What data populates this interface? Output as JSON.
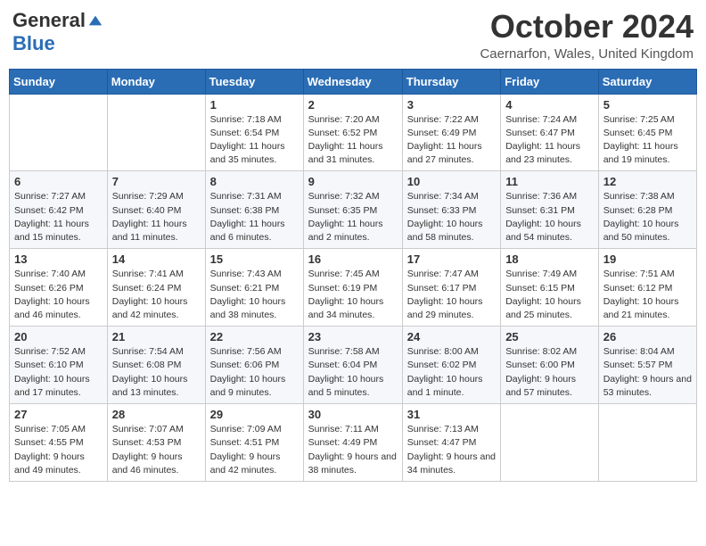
{
  "header": {
    "logo": {
      "general": "General",
      "blue": "Blue",
      "tagline": ""
    },
    "title": "October 2024",
    "location": "Caernarfon, Wales, United Kingdom"
  },
  "weekdays": [
    "Sunday",
    "Monday",
    "Tuesday",
    "Wednesday",
    "Thursday",
    "Friday",
    "Saturday"
  ],
  "weeks": [
    [
      {
        "day": "",
        "sunrise": "",
        "sunset": "",
        "daylight": ""
      },
      {
        "day": "",
        "sunrise": "",
        "sunset": "",
        "daylight": ""
      },
      {
        "day": "1",
        "sunrise": "Sunrise: 7:18 AM",
        "sunset": "Sunset: 6:54 PM",
        "daylight": "Daylight: 11 hours and 35 minutes."
      },
      {
        "day": "2",
        "sunrise": "Sunrise: 7:20 AM",
        "sunset": "Sunset: 6:52 PM",
        "daylight": "Daylight: 11 hours and 31 minutes."
      },
      {
        "day": "3",
        "sunrise": "Sunrise: 7:22 AM",
        "sunset": "Sunset: 6:49 PM",
        "daylight": "Daylight: 11 hours and 27 minutes."
      },
      {
        "day": "4",
        "sunrise": "Sunrise: 7:24 AM",
        "sunset": "Sunset: 6:47 PM",
        "daylight": "Daylight: 11 hours and 23 minutes."
      },
      {
        "day": "5",
        "sunrise": "Sunrise: 7:25 AM",
        "sunset": "Sunset: 6:45 PM",
        "daylight": "Daylight: 11 hours and 19 minutes."
      }
    ],
    [
      {
        "day": "6",
        "sunrise": "Sunrise: 7:27 AM",
        "sunset": "Sunset: 6:42 PM",
        "daylight": "Daylight: 11 hours and 15 minutes."
      },
      {
        "day": "7",
        "sunrise": "Sunrise: 7:29 AM",
        "sunset": "Sunset: 6:40 PM",
        "daylight": "Daylight: 11 hours and 11 minutes."
      },
      {
        "day": "8",
        "sunrise": "Sunrise: 7:31 AM",
        "sunset": "Sunset: 6:38 PM",
        "daylight": "Daylight: 11 hours and 6 minutes."
      },
      {
        "day": "9",
        "sunrise": "Sunrise: 7:32 AM",
        "sunset": "Sunset: 6:35 PM",
        "daylight": "Daylight: 11 hours and 2 minutes."
      },
      {
        "day": "10",
        "sunrise": "Sunrise: 7:34 AM",
        "sunset": "Sunset: 6:33 PM",
        "daylight": "Daylight: 10 hours and 58 minutes."
      },
      {
        "day": "11",
        "sunrise": "Sunrise: 7:36 AM",
        "sunset": "Sunset: 6:31 PM",
        "daylight": "Daylight: 10 hours and 54 minutes."
      },
      {
        "day": "12",
        "sunrise": "Sunrise: 7:38 AM",
        "sunset": "Sunset: 6:28 PM",
        "daylight": "Daylight: 10 hours and 50 minutes."
      }
    ],
    [
      {
        "day": "13",
        "sunrise": "Sunrise: 7:40 AM",
        "sunset": "Sunset: 6:26 PM",
        "daylight": "Daylight: 10 hours and 46 minutes."
      },
      {
        "day": "14",
        "sunrise": "Sunrise: 7:41 AM",
        "sunset": "Sunset: 6:24 PM",
        "daylight": "Daylight: 10 hours and 42 minutes."
      },
      {
        "day": "15",
        "sunrise": "Sunrise: 7:43 AM",
        "sunset": "Sunset: 6:21 PM",
        "daylight": "Daylight: 10 hours and 38 minutes."
      },
      {
        "day": "16",
        "sunrise": "Sunrise: 7:45 AM",
        "sunset": "Sunset: 6:19 PM",
        "daylight": "Daylight: 10 hours and 34 minutes."
      },
      {
        "day": "17",
        "sunrise": "Sunrise: 7:47 AM",
        "sunset": "Sunset: 6:17 PM",
        "daylight": "Daylight: 10 hours and 29 minutes."
      },
      {
        "day": "18",
        "sunrise": "Sunrise: 7:49 AM",
        "sunset": "Sunset: 6:15 PM",
        "daylight": "Daylight: 10 hours and 25 minutes."
      },
      {
        "day": "19",
        "sunrise": "Sunrise: 7:51 AM",
        "sunset": "Sunset: 6:12 PM",
        "daylight": "Daylight: 10 hours and 21 minutes."
      }
    ],
    [
      {
        "day": "20",
        "sunrise": "Sunrise: 7:52 AM",
        "sunset": "Sunset: 6:10 PM",
        "daylight": "Daylight: 10 hours and 17 minutes."
      },
      {
        "day": "21",
        "sunrise": "Sunrise: 7:54 AM",
        "sunset": "Sunset: 6:08 PM",
        "daylight": "Daylight: 10 hours and 13 minutes."
      },
      {
        "day": "22",
        "sunrise": "Sunrise: 7:56 AM",
        "sunset": "Sunset: 6:06 PM",
        "daylight": "Daylight: 10 hours and 9 minutes."
      },
      {
        "day": "23",
        "sunrise": "Sunrise: 7:58 AM",
        "sunset": "Sunset: 6:04 PM",
        "daylight": "Daylight: 10 hours and 5 minutes."
      },
      {
        "day": "24",
        "sunrise": "Sunrise: 8:00 AM",
        "sunset": "Sunset: 6:02 PM",
        "daylight": "Daylight: 10 hours and 1 minute."
      },
      {
        "day": "25",
        "sunrise": "Sunrise: 8:02 AM",
        "sunset": "Sunset: 6:00 PM",
        "daylight": "Daylight: 9 hours and 57 minutes."
      },
      {
        "day": "26",
        "sunrise": "Sunrise: 8:04 AM",
        "sunset": "Sunset: 5:57 PM",
        "daylight": "Daylight: 9 hours and 53 minutes."
      }
    ],
    [
      {
        "day": "27",
        "sunrise": "Sunrise: 7:05 AM",
        "sunset": "Sunset: 4:55 PM",
        "daylight": "Daylight: 9 hours and 49 minutes."
      },
      {
        "day": "28",
        "sunrise": "Sunrise: 7:07 AM",
        "sunset": "Sunset: 4:53 PM",
        "daylight": "Daylight: 9 hours and 46 minutes."
      },
      {
        "day": "29",
        "sunrise": "Sunrise: 7:09 AM",
        "sunset": "Sunset: 4:51 PM",
        "daylight": "Daylight: 9 hours and 42 minutes."
      },
      {
        "day": "30",
        "sunrise": "Sunrise: 7:11 AM",
        "sunset": "Sunset: 4:49 PM",
        "daylight": "Daylight: 9 hours and 38 minutes."
      },
      {
        "day": "31",
        "sunrise": "Sunrise: 7:13 AM",
        "sunset": "Sunset: 4:47 PM",
        "daylight": "Daylight: 9 hours and 34 minutes."
      },
      {
        "day": "",
        "sunrise": "",
        "sunset": "",
        "daylight": ""
      },
      {
        "day": "",
        "sunrise": "",
        "sunset": "",
        "daylight": ""
      }
    ]
  ]
}
